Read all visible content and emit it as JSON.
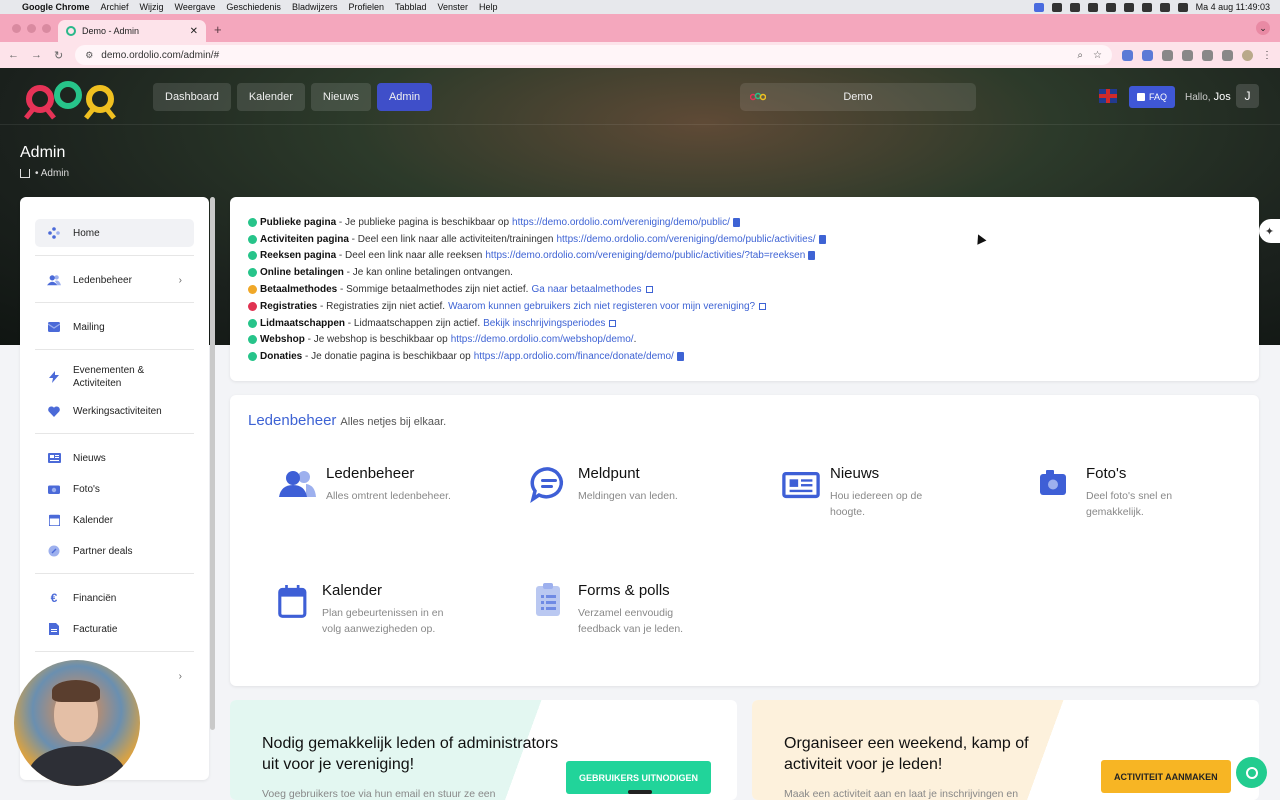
{
  "os_menubar": {
    "app": "Google Chrome",
    "menus": [
      "Archief",
      "Wijzig",
      "Weergave",
      "Geschiedenis",
      "Bladwijzers",
      "Profielen",
      "Tabblad",
      "Venster",
      "Help"
    ],
    "clock": "Ma 4 aug  11:49:03"
  },
  "browser": {
    "tab_title": "Demo - Admin",
    "url": "demo.ordolio.com/admin/#"
  },
  "header": {
    "nav": [
      {
        "label": "Dashboard",
        "active": false
      },
      {
        "label": "Kalender",
        "active": false
      },
      {
        "label": "Nieuws",
        "active": false
      },
      {
        "label": "Admin",
        "active": true
      }
    ],
    "org_name": "Demo",
    "faq_label": "FAQ",
    "greeting": "Hallo,",
    "user_name": "Jos",
    "user_initial": "J"
  },
  "page": {
    "title": "Admin",
    "breadcrumb": "• Admin"
  },
  "sidebar": {
    "items": [
      {
        "label": "Home",
        "icon": "home-diamond-icon"
      },
      {
        "label": "Ledenbeheer",
        "icon": "users-icon"
      },
      {
        "label": "Mailing",
        "icon": "envelope-icon"
      },
      {
        "label": "Evenementen & Activiteiten",
        "icon": "bolt-icon"
      },
      {
        "label": "Werkingsactiviteiten",
        "icon": "heart-icon"
      },
      {
        "label": "Nieuws",
        "icon": "newspaper-icon"
      },
      {
        "label": "Foto's",
        "icon": "camera-icon"
      },
      {
        "label": "Kalender",
        "icon": "calendar-icon"
      },
      {
        "label": "Partner deals",
        "icon": "badge-icon"
      },
      {
        "label": "Financiën",
        "icon": "euro-icon"
      },
      {
        "label": "Facturatie",
        "icon": "invoice-icon"
      }
    ]
  },
  "status": [
    {
      "color": "#27c48a",
      "label": "Publieke pagina",
      "text": " - Je publieke pagina is beschikbaar op",
      "link": "https://demo.ordolio.com/vereniging/demo/public/",
      "icon": "copy"
    },
    {
      "color": "#27c48a",
      "label": "Activiteiten pagina",
      "text": " - Deel een link naar alle activiteiten/trainingen",
      "link": "https://demo.ordolio.com/vereniging/demo/public/activities/",
      "icon": "copy"
    },
    {
      "color": "#27c48a",
      "label": "Reeksen pagina",
      "text": " - Deel een link naar alle reeksen",
      "link": "https://demo.ordolio.com/vereniging/demo/public/activities/?tab=reeksen",
      "icon": "copy"
    },
    {
      "color": "#27c48a",
      "label": "Online betalingen",
      "text": " - Je kan online betalingen ontvangen.",
      "link": "",
      "icon": ""
    },
    {
      "color": "#f0a828",
      "label": "Betaalmethodes",
      "text": " - Sommige betaalmethodes zijn niet actief.",
      "link": "Ga naar betaalmethodes",
      "icon": "external"
    },
    {
      "color": "#e03251",
      "label": "Registraties",
      "text": " - Registraties zijn niet actief.",
      "link": "Waarom kunnen gebruikers zich niet registeren voor mijn vereniging?",
      "icon": "external"
    },
    {
      "color": "#27c48a",
      "label": "Lidmaatschappen",
      "text": " - Lidmaatschappen zijn actief.",
      "link": "Bekijk inschrijvingsperiodes",
      "icon": "external"
    },
    {
      "color": "#27c48a",
      "label": "Webshop",
      "text": " - Je webshop is beschikbaar op",
      "link": "https://demo.ordolio.com/webshop/demo/",
      "icon": "period"
    },
    {
      "color": "#27c48a",
      "label": "Donaties",
      "text": " - Je donatie pagina is beschikbaar op",
      "link": "https://app.ordolio.com/finance/donate/demo/",
      "icon": "copy"
    }
  ],
  "members": {
    "heading": "Ledenbeheer",
    "subheading": "Alles netjes bij elkaar.",
    "features": [
      {
        "title": "Ledenbeheer",
        "desc": "Alles omtrent ledenbeheer.",
        "icon": "users-icon"
      },
      {
        "title": "Meldpunt",
        "desc": "Meldingen van leden.",
        "icon": "chat-bubble-icon"
      },
      {
        "title": "Nieuws",
        "desc": "Hou iedereen op de hoogte.",
        "icon": "newspaper-icon"
      },
      {
        "title": "Foto's",
        "desc": "Deel foto's snel en gemakkelijk.",
        "icon": "camera-icon"
      },
      {
        "title": "Kalender",
        "desc": "Plan gebeurtenissen in en volg aanwezigheden op.",
        "icon": "calendar-icon"
      },
      {
        "title": "Forms & polls",
        "desc": "Verzamel eenvoudig feedback van je leden.",
        "icon": "clipboard-icon"
      }
    ]
  },
  "promos": {
    "left": {
      "title": "Nodig gemakkelijk leden of administrators uit voor je vereniging!",
      "text": "Voeg gebruikers toe via hun email en stuur ze een",
      "cta": "GEBRUIKERS UITNODIGEN"
    },
    "right": {
      "title": "Organiseer een weekend, kamp of activiteit voor je leden!",
      "text": "Maak een activiteit aan en laat je inschrijvingen en",
      "cta": "ACTIVITEIT AANMAKEN"
    }
  },
  "colors": {
    "accent": "#3f4fc9",
    "link": "#3e63d4",
    "success": "#27c48a",
    "warning": "#f0a828",
    "danger": "#e03251"
  }
}
